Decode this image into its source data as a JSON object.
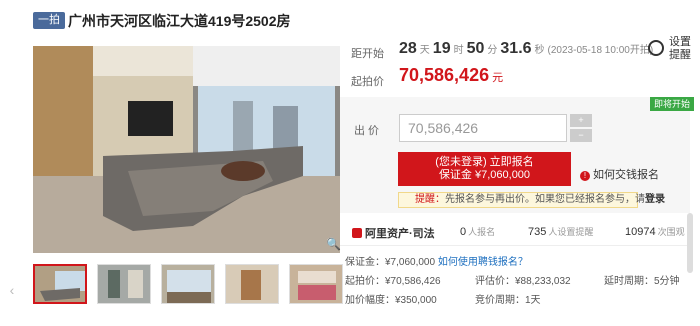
{
  "header": {
    "tag": "一拍",
    "title": "广州市天河区临江大道419号2502房"
  },
  "countdown": {
    "label": "距开始",
    "days": "28",
    "days_unit": "天",
    "hours": "19",
    "hours_unit": "时",
    "minutes": "50",
    "minutes_unit": "分",
    "seconds": "31.6",
    "seconds_unit": "秒",
    "start_time": "(2023-05-18 10:00开拍)"
  },
  "remind": {
    "label": "设置提醒"
  },
  "start_price": {
    "label": "起拍价",
    "value": "70,586,426",
    "unit": "元"
  },
  "bid": {
    "badge": "即将开始",
    "label": "出 价",
    "value": "70,586,426",
    "up": "+",
    "down": "−"
  },
  "signup": {
    "line1": "(您未登录) 立即报名",
    "line2": "保证金 ¥7,060,000"
  },
  "howto": {
    "label": "如何交钱报名"
  },
  "notice": {
    "prefix": "提醒：",
    "text": "先报名参与再出价。如果您已经报名参与，请",
    "link": "登录"
  },
  "stats": {
    "brand": "阿里资产·司法",
    "signups": "0",
    "signups_label": "人报名",
    "reminders": "735",
    "reminders_label": "人设置提醒",
    "views": "10974",
    "views_label": "次围观"
  },
  "info": {
    "deposit": "保证金：¥7,060,000",
    "deposit_link": "如何使用聘钱报名？",
    "start": "起拍价：¥70,586,426",
    "appraisal": "评估价：¥88,233,032",
    "delay": "延时周期：",
    "delay_value": "5分钟",
    "increment": "加价幅度：¥350,000",
    "cycle": "竞价周期：",
    "cycle_value": "1天"
  },
  "zoom_icon": "magnifier-icon",
  "colors": {
    "accent": "#d1161b",
    "tag": "#4a6a9b",
    "green": "#3aa844"
  }
}
